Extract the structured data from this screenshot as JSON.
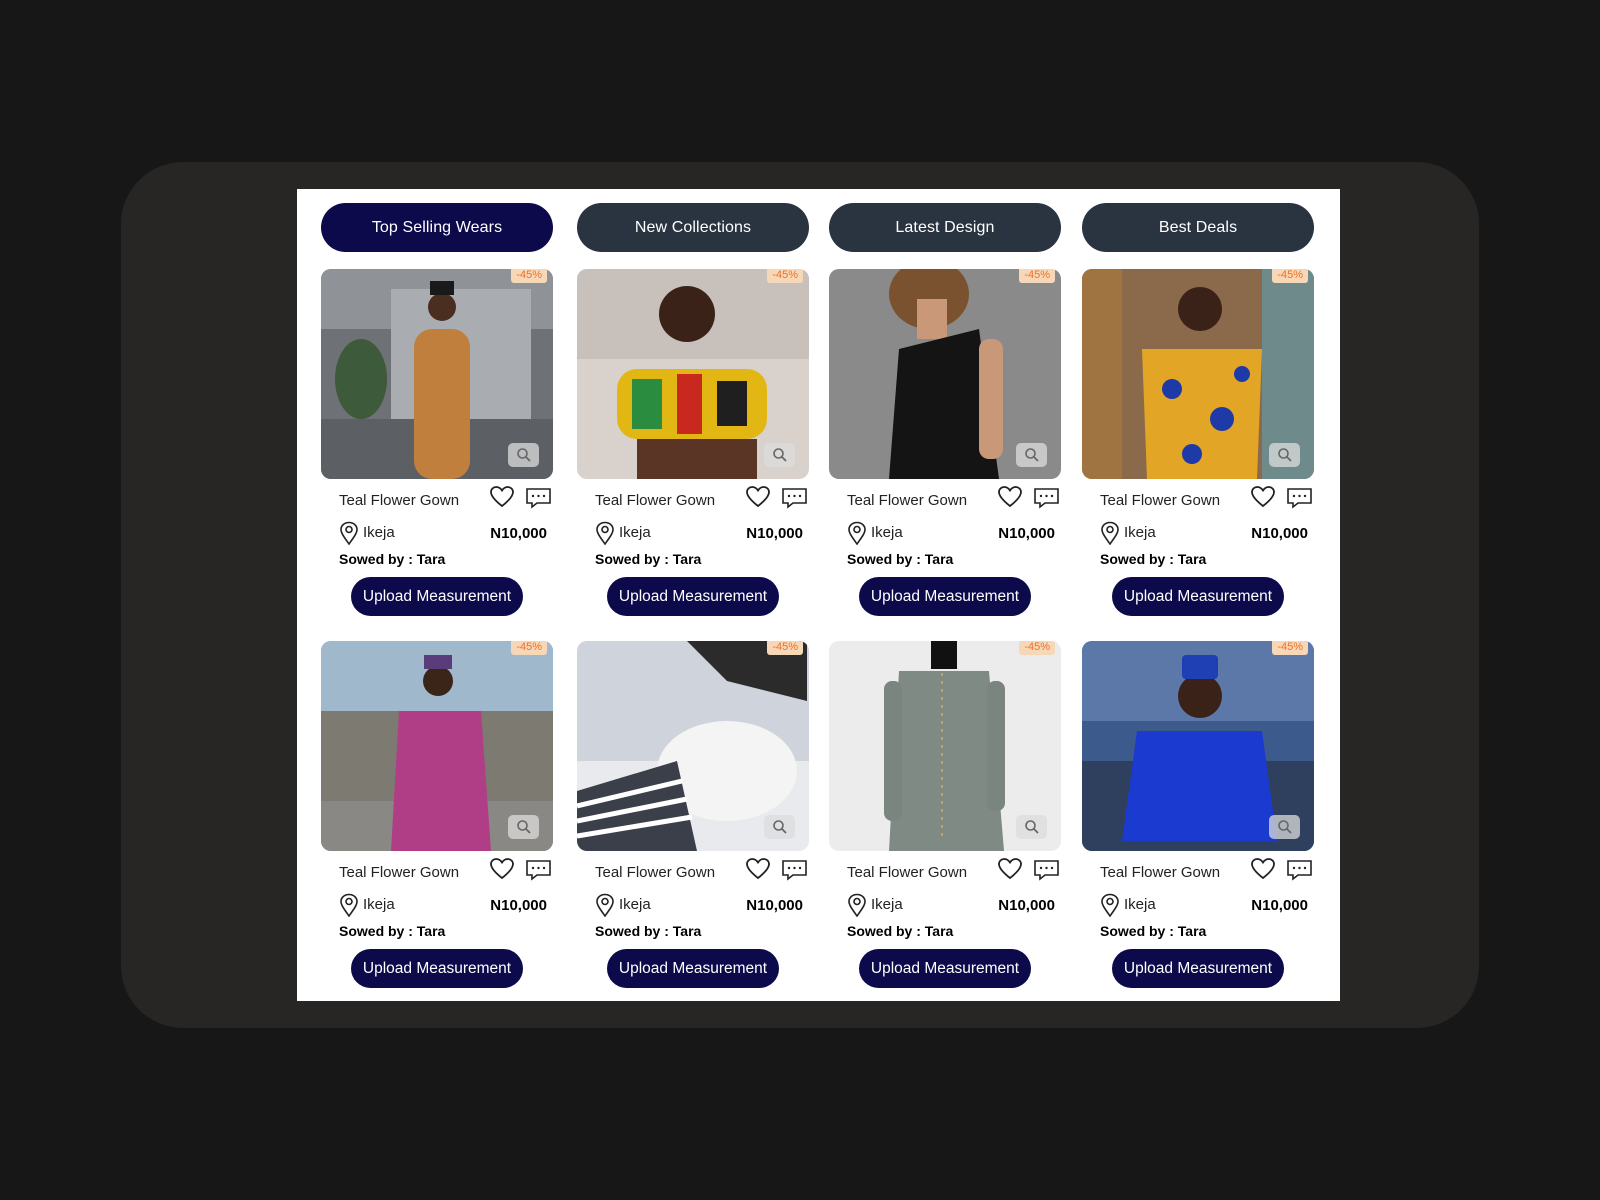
{
  "tabs": [
    {
      "label": "Top Selling Wears",
      "active": true
    },
    {
      "label": "New Collections",
      "active": false
    },
    {
      "label": "Latest Design",
      "active": false
    },
    {
      "label": "Best Deals",
      "active": false
    }
  ],
  "products": [
    {
      "discount": "-45%",
      "title": "Teal Flower Gown",
      "location": "Ikeja",
      "price": "N10,000",
      "sowed_by": "Sowed by : Tara",
      "upload_label": "Upload Measurement"
    },
    {
      "discount": "-45%",
      "title": "Teal Flower Gown",
      "location": "Ikeja",
      "price": "N10,000",
      "sowed_by": "Sowed by : Tara",
      "upload_label": "Upload Measurement"
    },
    {
      "discount": "-45%",
      "title": "Teal Flower Gown",
      "location": "Ikeja",
      "price": "N10,000",
      "sowed_by": "Sowed by : Tara",
      "upload_label": "Upload Measurement"
    },
    {
      "discount": "-45%",
      "title": "Teal Flower Gown",
      "location": "Ikeja",
      "price": "N10,000",
      "sowed_by": "Sowed by : Tara",
      "upload_label": "Upload Measurement"
    },
    {
      "discount": "-45%",
      "title": "Teal Flower Gown",
      "location": "Ikeja",
      "price": "N10,000",
      "sowed_by": "Sowed by : Tara",
      "upload_label": "Upload Measurement"
    },
    {
      "discount": "-45%",
      "title": "Teal Flower Gown",
      "location": "Ikeja",
      "price": "N10,000",
      "sowed_by": "Sowed by : Tara",
      "upload_label": "Upload Measurement"
    },
    {
      "discount": "-45%",
      "title": "Teal Flower Gown",
      "location": "Ikeja",
      "price": "N10,000",
      "sowed_by": "Sowed by : Tara",
      "upload_label": "Upload Measurement"
    },
    {
      "discount": "-45%",
      "title": "Teal Flower Gown",
      "location": "Ikeja",
      "price": "N10,000",
      "sowed_by": "Sowed by : Tara",
      "upload_label": "Upload Measurement"
    }
  ],
  "icons": {
    "favorite": "heart-icon",
    "message": "chat-icon",
    "location": "location-pin-icon",
    "zoom": "magnifier-icon"
  },
  "colors": {
    "accent": "#0c0a4a",
    "tab": "#2a3340",
    "discount": "#f37021",
    "frame": "#282624",
    "background": "#171717"
  }
}
